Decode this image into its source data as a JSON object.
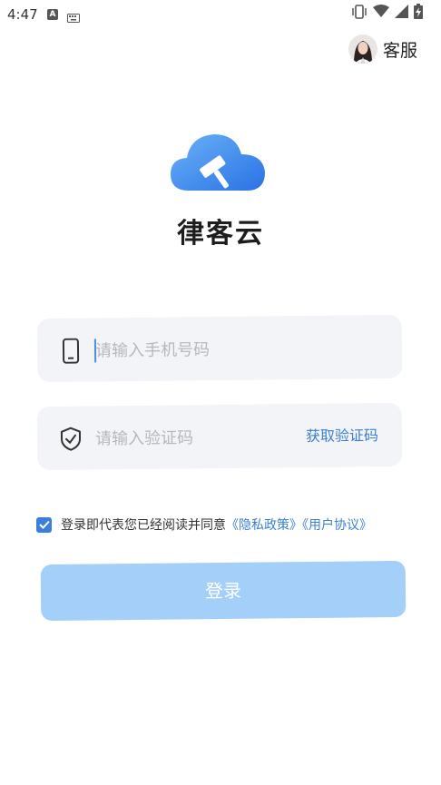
{
  "status_bar": {
    "time": "4:47",
    "notification_icons": [
      "a-icon",
      "keyboard-icon"
    ],
    "right_icons": [
      "vibrate-icon",
      "wifi-icon",
      "signal-icon",
      "battery-charging-icon"
    ]
  },
  "header": {
    "customer_service_label": "客服"
  },
  "app": {
    "title": "律客云",
    "logo_colors": [
      "#5aa6f5",
      "#2a75e6"
    ]
  },
  "form": {
    "phone_placeholder": "请输入手机号码",
    "phone_value": "",
    "code_placeholder": "请输入验证码",
    "code_value": "",
    "get_code_label": "获取验证码"
  },
  "agreement": {
    "checked": true,
    "text": "登录即代表您已经阅读并同意",
    "privacy_link": "《隐私政策》",
    "user_link": "《用户协议》"
  },
  "login_button": {
    "label": "登录",
    "color": "#a3cff8"
  },
  "colors": {
    "accent": "#3b7fd0",
    "input_bg": "#f3f4f7"
  }
}
